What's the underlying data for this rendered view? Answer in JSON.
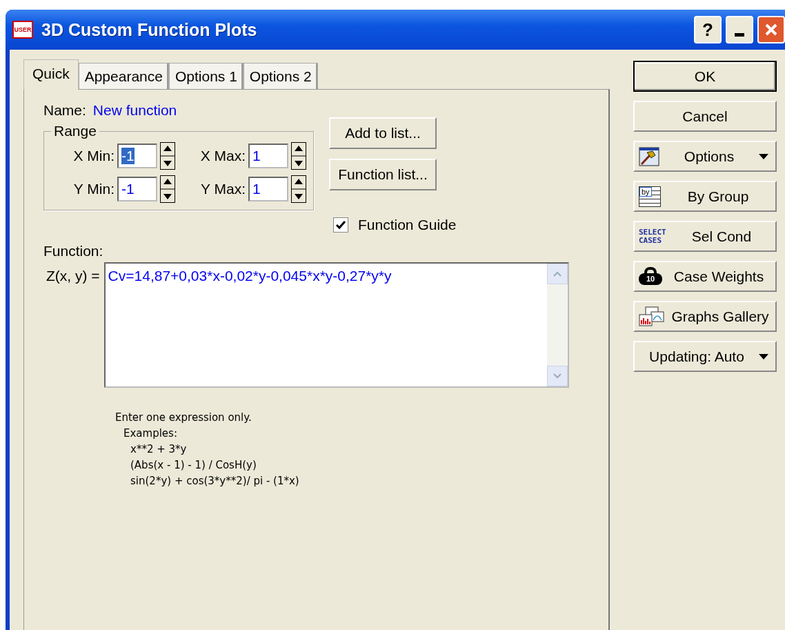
{
  "window": {
    "title": "3D Custom Function Plots",
    "icon_label": "USER",
    "buttons": [
      {
        "kind": "help",
        "label": "?"
      },
      {
        "kind": "minimize"
      },
      {
        "kind": "close"
      }
    ]
  },
  "tabs": [
    {
      "label": "Quick",
      "selected": true
    },
    {
      "label": "Appearance",
      "selected": false
    },
    {
      "label": "Options 1",
      "selected": false
    },
    {
      "label": "Options 2",
      "selected": false
    }
  ],
  "name": {
    "label": "Name:",
    "value": "New function"
  },
  "range": {
    "title": "Range",
    "fields": [
      {
        "label": "X Min:",
        "value": "-1",
        "selected": true
      },
      {
        "label": "X Max:",
        "value": "1",
        "selected": false
      },
      {
        "label": "Y Min:",
        "value": "-1",
        "selected": false
      },
      {
        "label": "Y Max:",
        "value": "1",
        "selected": false
      }
    ]
  },
  "list_buttons": [
    "Add to list...",
    "Function list..."
  ],
  "function_guide": {
    "label": "Function Guide",
    "checked": true
  },
  "function": {
    "heading": "Function:",
    "label": "Z(x, y) =",
    "value": "Cv=14,87+0,03*x-0,02*y-0,045*x*y-0,27*y*y"
  },
  "help_lines": [
    "Enter one expression only.",
    "Examples:",
    "x**2 + 3*y",
    "(Abs(x - 1) - 1) / CosH(y)",
    "sin(2*y) + cos(3*y**2)/ pi - (1*x)"
  ],
  "side_buttons": [
    {
      "kind": "default",
      "label": "OK"
    },
    {
      "kind": "plain",
      "label": "Cancel"
    },
    {
      "kind": "hammer",
      "label": "Options",
      "dropdown": true
    },
    {
      "kind": "bygroup",
      "label": "By Group",
      "icon_text": "by"
    },
    {
      "kind": "select",
      "label": "Sel Cond",
      "icon_text": "SELECT CASES"
    },
    {
      "kind": "weight",
      "label": "Case Weights",
      "icon_text": "10"
    },
    {
      "kind": "gallery",
      "label": "Graphs Gallery"
    },
    {
      "kind": "plain",
      "label": "Updating: Auto",
      "dropdown": true
    }
  ]
}
